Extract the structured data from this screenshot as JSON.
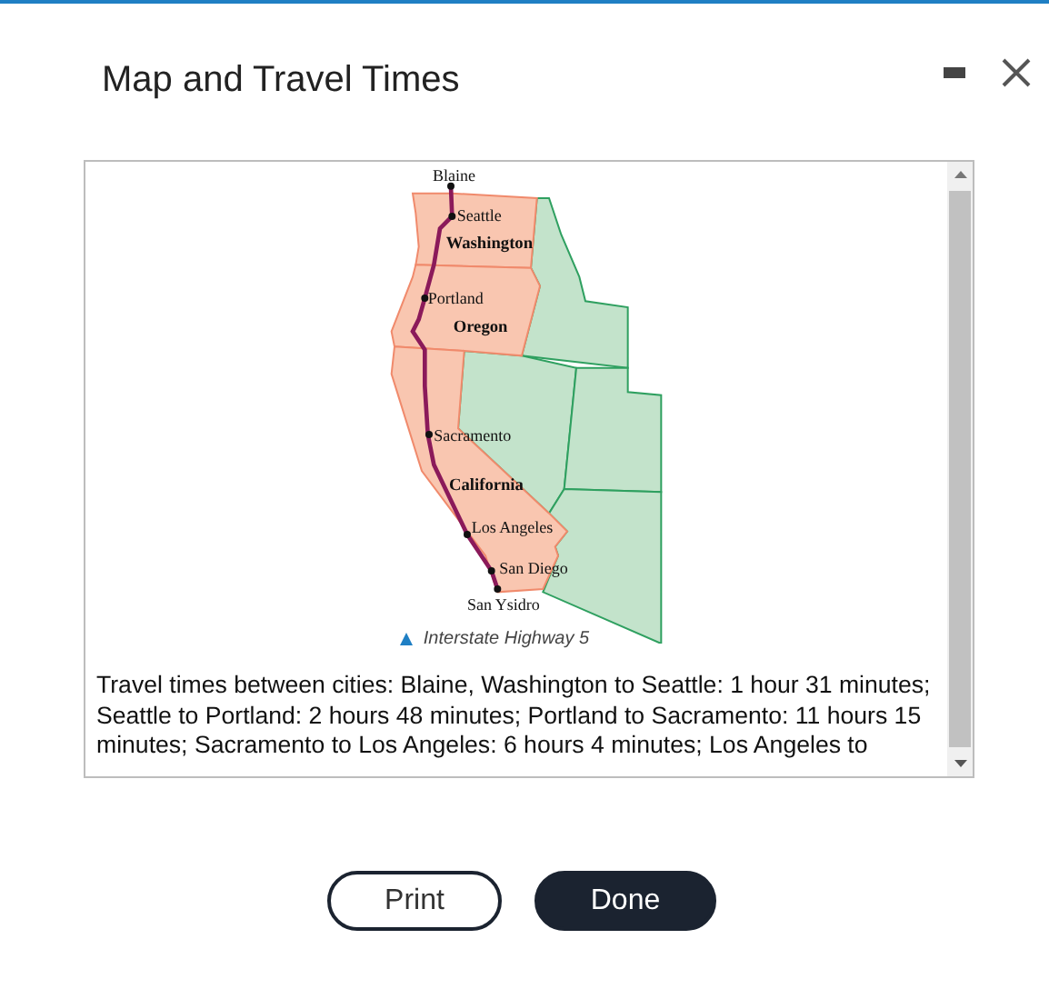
{
  "dialog": {
    "title": "Map and Travel Times"
  },
  "map": {
    "labels": [
      {
        "text": "Blaine",
        "kind": "city"
      },
      {
        "text": "Seattle",
        "kind": "city"
      },
      {
        "text": "Washington",
        "kind": "state"
      },
      {
        "text": "Portland",
        "kind": "city"
      },
      {
        "text": "Oregon",
        "kind": "state"
      },
      {
        "text": "Sacramento",
        "kind": "city"
      },
      {
        "text": "California",
        "kind": "state"
      },
      {
        "text": "Los Angeles",
        "kind": "city"
      },
      {
        "text": "San Diego",
        "kind": "city"
      },
      {
        "text": "San Ysidro",
        "kind": "city"
      }
    ],
    "legend": "Interstate Highway 5"
  },
  "description": "Travel times between cities: Blaine, Washington to Seattle: 1 hour 31 minutes; Seattle to Portland: 2 hours 48 minutes; Portland to Sacramento: 11 hours 15 minutes; Sacramento to Los Angeles: 6 hours 4 minutes; Los Angeles to",
  "buttons": [
    {
      "label": "Print",
      "kind": "secondary"
    },
    {
      "label": "Done",
      "kind": "primary"
    }
  ]
}
